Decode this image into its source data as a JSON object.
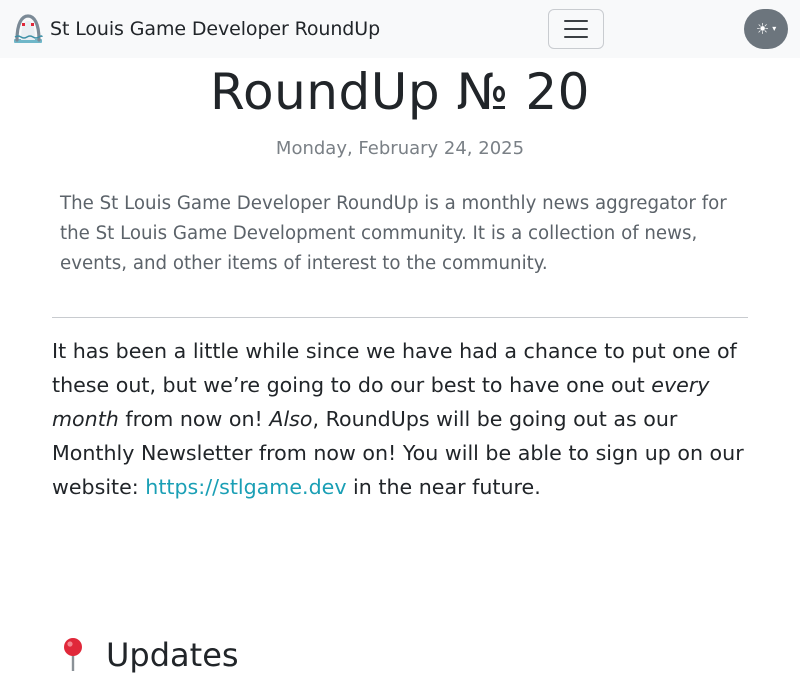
{
  "navbar": {
    "brand_text": "St Louis Game Developer RoundUp",
    "brand_logo_icon": "gateway-arch-logo-icon",
    "menu_toggle_icon": "hamburger-menu-icon",
    "theme_toggle_icon": "sun-icon",
    "theme_toggle_symbol": "☀",
    "theme_toggle_caret": "▾",
    "background_color": "#f8f9fa",
    "theme_button_color": "#6c757d"
  },
  "header": {
    "title": "RoundUp № 20",
    "date": "Monday, February 24, 2025",
    "lead": "The St Louis Game Developer RoundUp is a monthly news aggregator for the St Louis Game Development community. It is a collection of news, events, and other items of interest to the community."
  },
  "intro": {
    "part1": "It has been a little while since we have had a chance to put one of these out, but we’re going to do our best to have one out ",
    "emphasis1": "every month",
    "part2": " from now on! ",
    "emphasis2": "Also",
    "part3": ", RoundUps will be going out as our Monthly Newsletter from now on! You will be able to sign up on our website: ",
    "link_text": "https://stlgame.dev",
    "part4": " in the near future."
  },
  "sections": [
    {
      "heading": "Updates",
      "icon": "round-pushpin-icon"
    }
  ],
  "colors": {
    "link": "#1a9fb5",
    "muted_text": "#7a8086",
    "lead_text": "#5c636a",
    "pin_red": "#e0283a"
  }
}
